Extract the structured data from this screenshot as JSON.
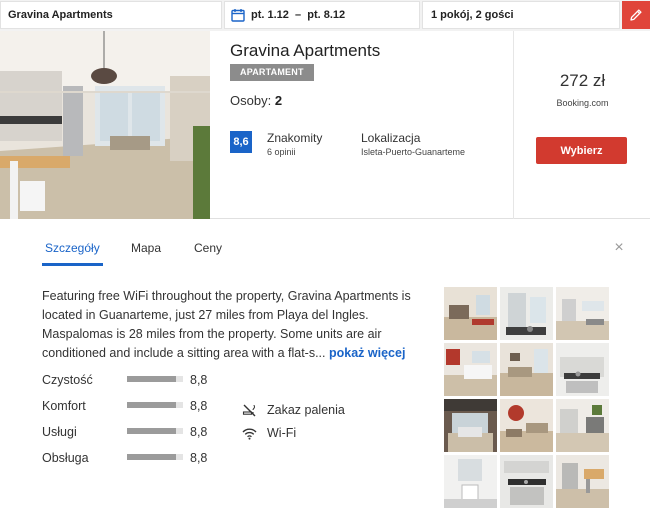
{
  "search": {
    "hotel_name": "Gravina Apartments",
    "dates": "pt. 1.12  –  pt. 8.12",
    "guests": "1 pokój, 2 gości"
  },
  "hotel": {
    "name": "Gravina Apartments",
    "type": "APARTAMENT",
    "guests_label": "Osoby:",
    "guests_value": "2",
    "score": "8,6",
    "score_word": "Znakomity",
    "review_count": "6 opinii",
    "location_label": "Lokalizacja",
    "location_value": "Isleta-Puerto-Guanarteme",
    "price": "272 zł",
    "provider": "Booking.com",
    "select_label": "Wybierz"
  },
  "tabs": [
    {
      "label": "Szczegóły",
      "active": true
    },
    {
      "label": "Mapa",
      "active": false
    },
    {
      "label": "Ceny",
      "active": false
    }
  ],
  "close_label": "×",
  "description": {
    "text": "Featuring free WiFi throughout the property, Gravina Apartments is located in Guanarteme, just 27 miles from Playa del Ingles. Maspalomas is 28 miles from the property. Some units are air conditioned and include a sitting area with a flat-s...",
    "more_link": "pokaż więcej"
  },
  "ratings": [
    {
      "label": "Czystość",
      "value": "8,8",
      "fraction": 0.88
    },
    {
      "label": "Komfort",
      "value": "8,8",
      "fraction": 0.88
    },
    {
      "label": "Usługi",
      "value": "8,8",
      "fraction": 0.88
    },
    {
      "label": "Obsługa",
      "value": "8,8",
      "fraction": 0.88
    }
  ],
  "amenities": [
    {
      "label": "Zakaz palenia",
      "icon": "no-smoking-icon"
    },
    {
      "label": "Wi-Fi",
      "icon": "wifi-icon"
    }
  ],
  "colors": {
    "accent_blue": "#1a64c8",
    "button_red": "#d23a2f",
    "edit_red": "#e0453a",
    "badge_grey": "#8c8c8c"
  }
}
